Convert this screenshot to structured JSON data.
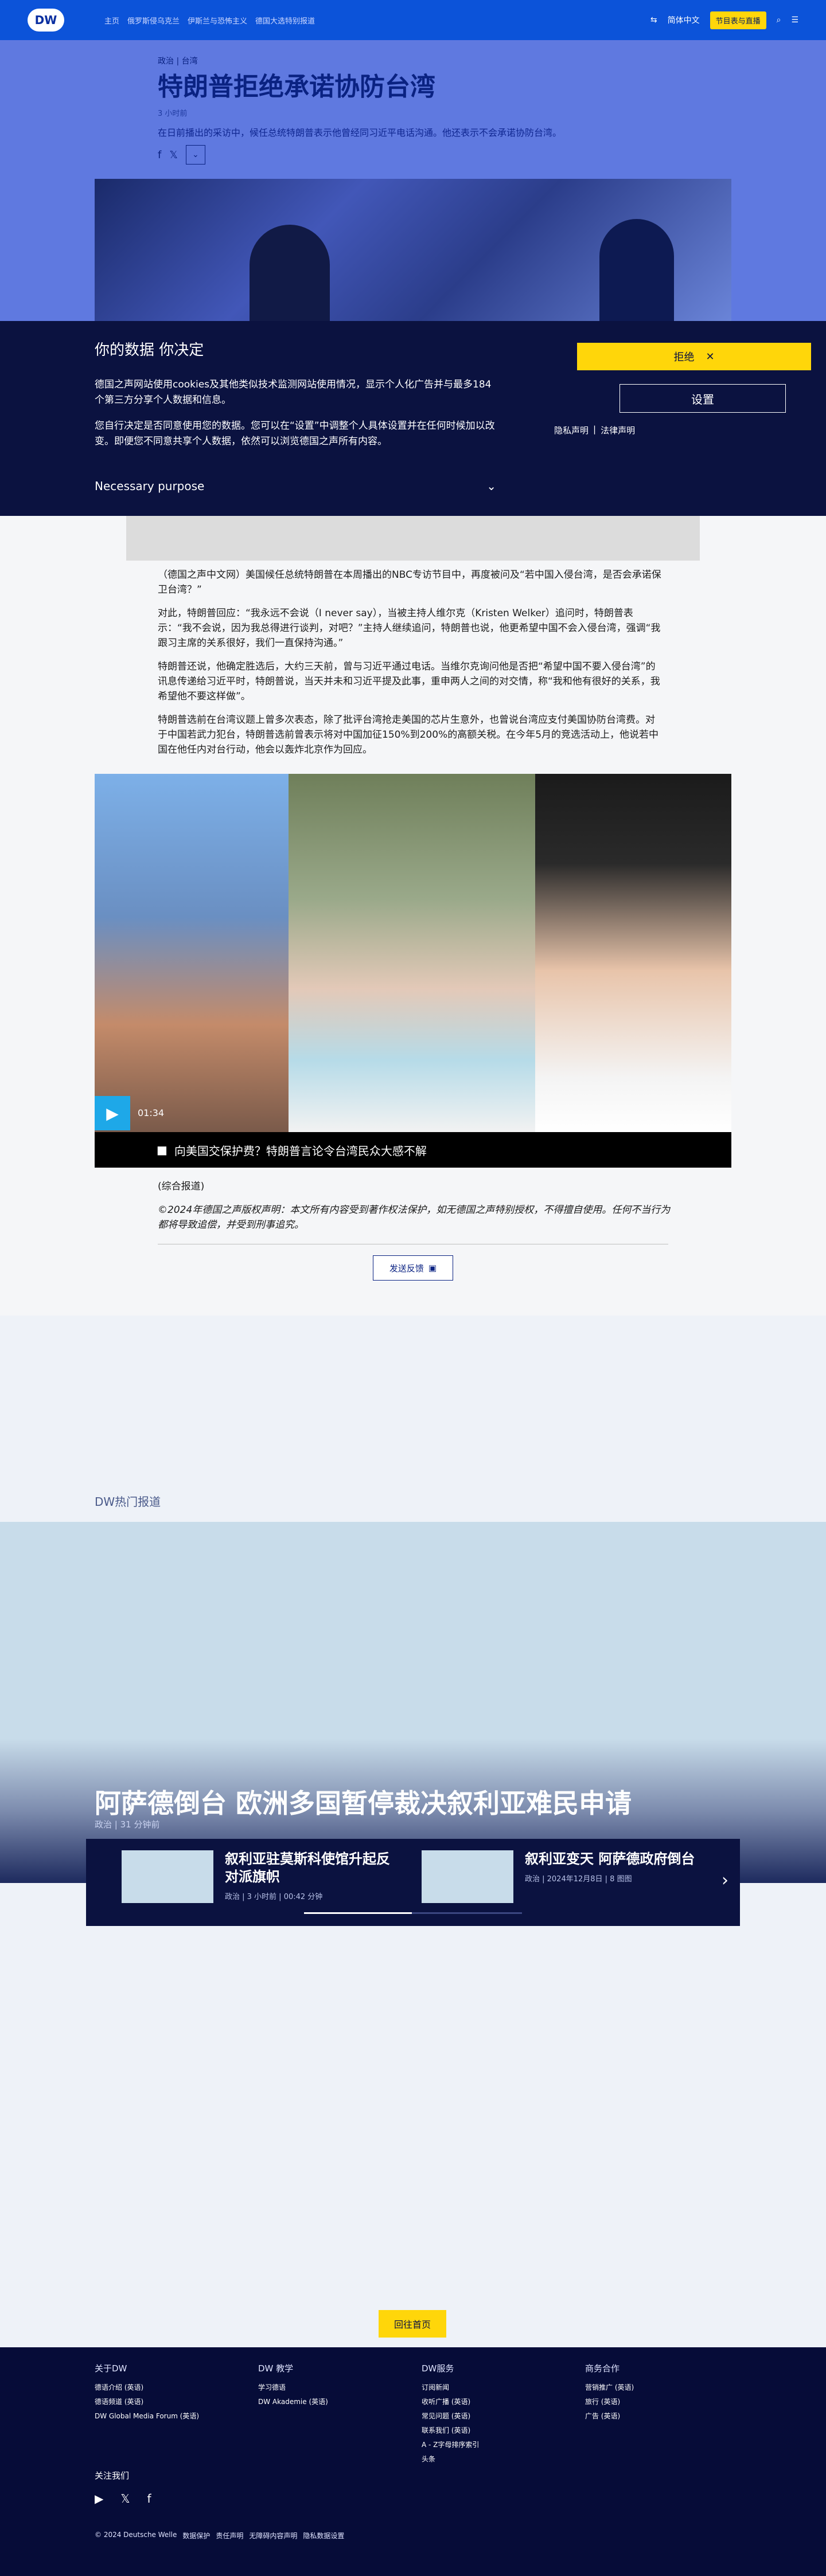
{
  "nav": {
    "logo": "DW",
    "links": [
      "主页",
      "俄罗斯侵乌克兰",
      "伊斯兰与恐怖主义",
      "德国大选特别报道"
    ],
    "language": "简体中文",
    "live_label": "节目表与直播"
  },
  "article": {
    "kicker": "政治 | 台湾",
    "headline": "特朗普拒绝承诺协防台湾",
    "meta": "3 小时前",
    "lead": "在日前播出的采访中，候任总统特朗普表示他曾经同习近平电话沟通。他还表示不会承诺协防台湾。",
    "share": {
      "facebook": "f",
      "x": "𝕏",
      "more": "⌄"
    }
  },
  "consent": {
    "title": "你的数据 你决定",
    "p1": "德国之声网站使用cookies及其他类似技术监测网站使用情况，显示个人化广告并与最多184 个第三方分享个人数据和信息。",
    "p2": "您自行决定是否同意使用您的数据。您可以在“设置”中调整个人具体设置并在任何时候加以改变。即便您不同意共享个人数据，依然可以浏览德国之声所有内容。",
    "purpose": "Necessary purpose",
    "purpose_chevron": "⌄",
    "reject": "拒绝",
    "reject_icon": "✕",
    "settings": "设置",
    "privacy": "隐私声明",
    "legal": "法律声明"
  },
  "body": {
    "paragraphs": [
      "（德国之声中文网）美国候任总统特朗普在本周播出的NBC专访节目中，再度被问及“若中国入侵台湾，是否会承诺保卫台湾？”",
      "对此，特朗普回应：“我永远不会说（I never say），当被主持人维尔克（Kristen Welker）追问时，特朗普表示：“我不会说，因为我总得进行谈判，对吧？”主持人继续追问，特朗普也说，他更希望中国不会入侵台湾，强调“我跟习主席的关系很好，我们一直保持沟通。”",
      "特朗普还说，他确定胜选后，大约三天前，曾与习近平通过电话。当维尔克询问他是否把“希望中国不要入侵台湾”的讯息传递给习近平时，特朗普说，当天并未和习近平提及此事，重申两人之间的对交情，称“我和他有很好的关系，我希望他不要这样做”。",
      "特朗普选前在台湾议题上曾多次表态，除了批评台湾抢走美国的芯片生意外，也曾说台湾应支付美国协防台湾费。对于中国若武力犯台，特朗普选前曾表示将对中国加征150%到200%的高额关税。在今年5月的竞选活动上，他说若中国在他任内对台行动，他会以轰炸北京作为回应。"
    ],
    "video_duration": "01:34",
    "video_caption": "向美国交保护费？特朗普言论令台湾民众大感不解",
    "video_icon": "▶",
    "source": "(综合报道)",
    "copyright": "©2024年德国之声版权声明：本文所有内容受到著作权法保护，如无德国之声特别授权，不得擅自使用。任何不当行为都将导致追偿，并受到刑事追究。",
    "feedback": "发送反馈"
  },
  "hot": {
    "label": "DW热门报道",
    "teaser_title": "阿萨德倒台 欧洲多国暂停裁决叙利亚难民申请",
    "teaser_meta": "政治 | 31 分钟前",
    "cards": [
      {
        "title": "叙利亚驻莫斯科使馆升起反对派旗帜",
        "meta": "政治 | 3 小时前 | 00:42 分钟"
      },
      {
        "title": "叙利亚变天 阿萨德政府倒台",
        "meta": "政治 | 2024年12月8日 | 8 图图"
      }
    ],
    "next": "›"
  },
  "back_top": "回往首页",
  "footer": {
    "cols": [
      {
        "title": "关于DW",
        "items": [
          "德语介绍 (英语)",
          "德语频道 (英语)",
          "DW Global Media Forum (英语)"
        ]
      },
      {
        "title": "DW 教学",
        "items": [
          "学习德语",
          "DW Akademie (英语)"
        ]
      },
      {
        "title": "DW服务",
        "items": [
          "订阅新闻",
          "收听广播 (英语)",
          "常见问题 (英语)",
          "联系我们 (英语)",
          "A - Z字母排序索引",
          "头条"
        ]
      },
      {
        "title": "商务合作",
        "items": [
          "营销推广 (英语)",
          "旅行 (英语)",
          "广告 (英语)"
        ]
      }
    ],
    "follow": "关注我们",
    "socials": [
      "▶",
      "𝕏",
      "f"
    ],
    "legal": [
      "© 2024 Deutsche Welle",
      "数据保护",
      "责任声明",
      "无障碍内容声明",
      "隐私数据设置"
    ]
  }
}
